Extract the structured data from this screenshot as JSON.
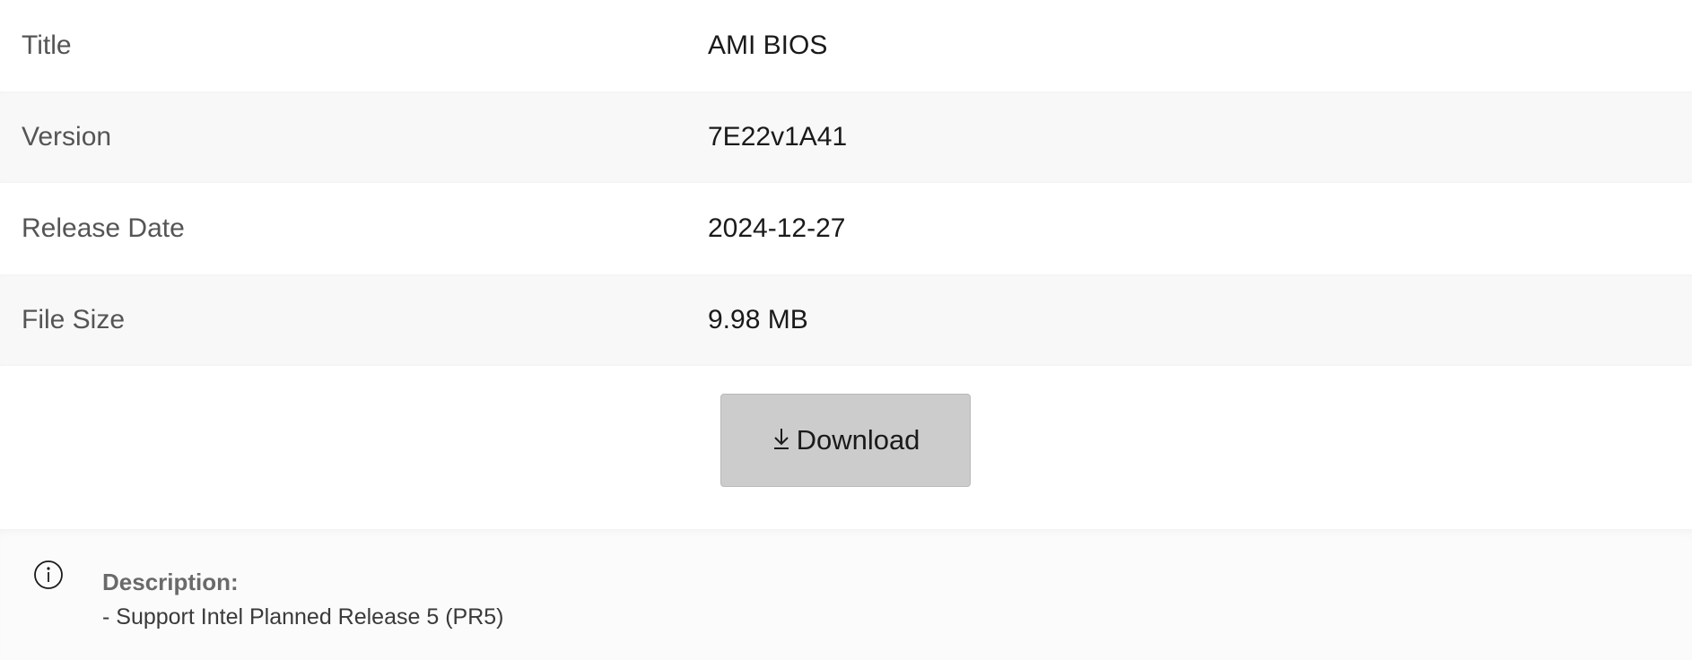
{
  "details": {
    "rows": [
      {
        "label": "Title",
        "value": "AMI BIOS"
      },
      {
        "label": "Version",
        "value": "7E22v1A41"
      },
      {
        "label": "Release Date",
        "value": "2024-12-27"
      },
      {
        "label": "File Size",
        "value": "9.98 MB"
      }
    ]
  },
  "download": {
    "label": "Download",
    "icon": "download-arrow-icon"
  },
  "description": {
    "icon": "info-icon",
    "heading": "Description:",
    "text": "- Support Intel Planned Release 5 (PR5)"
  },
  "colors": {
    "button_bg": "#cccccc",
    "alt_row_bg": "#f8f8f8",
    "label_text": "#555555"
  }
}
